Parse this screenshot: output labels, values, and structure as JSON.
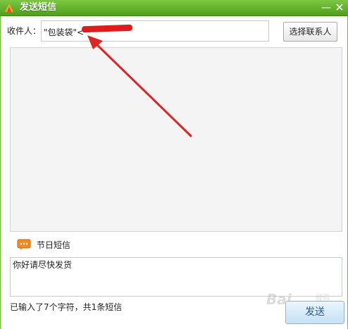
{
  "window": {
    "title": "发送短信",
    "minimize_glyph": "—",
    "close_glyph": "✕",
    "accent_color": "#5aab24"
  },
  "recipient": {
    "label": "收件人：",
    "value": "\"包装袋\"<",
    "select_contact_label": "选择联系人"
  },
  "holiday": {
    "icon": "speech-bubble-icon",
    "label": "节日短信"
  },
  "message": {
    "text": "你好请尽快发货",
    "count_text": "已输入了7个字符，共1条短信"
  },
  "send_button": {
    "label": "发送"
  },
  "watermark": {
    "text": "Bai",
    "sub": "经验"
  },
  "annotation": {
    "arrow_color": "#e02424"
  }
}
